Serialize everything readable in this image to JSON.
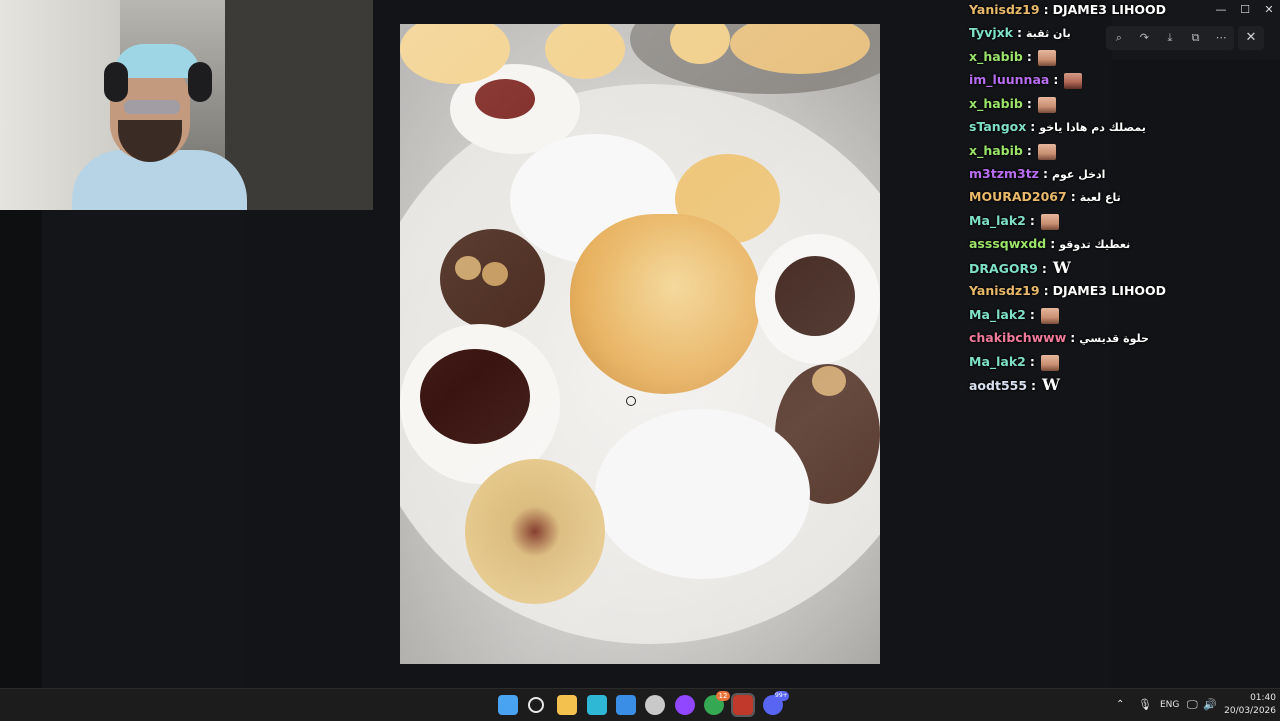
{
  "chat": {
    "lines": [
      {
        "user": "Yanisdz19",
        "user_color": "#e8b96a",
        "message": "DJAME3 LIHOOD",
        "emote": ""
      },
      {
        "user": "Tyvjxk",
        "user_color": "#7fe0c8",
        "message": "بان ثقبة",
        "emote": ""
      },
      {
        "user": "x_habib",
        "user_color": "#9be36a",
        "message": "",
        "emote": "face-emote"
      },
      {
        "user": "im_luunnaa",
        "user_color": "#b86ef0",
        "message": "",
        "emote": "face-emote-2"
      },
      {
        "user": "x_habib",
        "user_color": "#9be36a",
        "message": "",
        "emote": "face-emote"
      },
      {
        "user": "sTangox",
        "user_color": "#7fe0c8",
        "message": "يمصلك دم هادا ياخو",
        "emote": ""
      },
      {
        "user": "x_habib",
        "user_color": "#9be36a",
        "message": "",
        "emote": "face-emote"
      },
      {
        "user": "m3tzm3tz",
        "user_color": "#b86ef0",
        "message": "ادخل عوم",
        "emote": ""
      },
      {
        "user": "MOURAD2067",
        "user_color": "#e8b96a",
        "message": "تاع لعبة",
        "emote": ""
      },
      {
        "user": "Ma_lak2",
        "user_color": "#7fe0c8",
        "message": "",
        "emote": "face-emote"
      },
      {
        "user": "asssqwxdd",
        "user_color": "#9be36a",
        "message": "نعطيك تدوقو",
        "emote": ""
      },
      {
        "user": "DRAGOR9",
        "user_color": "#7fe0c8",
        "message": "",
        "emote": "w-emote"
      },
      {
        "user": "Yanisdz19",
        "user_color": "#e8b96a",
        "message": "DJAME3 LIHOOD",
        "emote": ""
      },
      {
        "user": "Ma_lak2",
        "user_color": "#7fe0c8",
        "message": "",
        "emote": "face-emote"
      },
      {
        "user": "chakibchwww",
        "user_color": "#f07a9a",
        "message": "حلوة قديسي",
        "emote": ""
      },
      {
        "user": "Ma_lak2",
        "user_color": "#7fe0c8",
        "message": "",
        "emote": "face-emote"
      },
      {
        "user": "aodt555",
        "user_color": "#d8e0f0",
        "message": "",
        "emote": "w-emote"
      }
    ],
    "separator": ":",
    "w_glyph": "W"
  },
  "viewer": {
    "toolbar_icons": [
      "zoom-icon",
      "forward-icon",
      "download-icon",
      "open-external-icon",
      "more-icon"
    ],
    "toolbar_glyphs": [
      "⌕",
      "↷",
      "⤓",
      "⧉",
      "⋯"
    ],
    "close_glyph": "✕"
  },
  "window_controls": {
    "minimize": "—",
    "maximize": "☐",
    "close": "✕"
  },
  "taskbar": {
    "tray": {
      "language": "ENG",
      "time": "01:40",
      "date": "20/03/2026"
    },
    "apps": [
      {
        "name": "start-icon",
        "color": "#4aa3f0"
      },
      {
        "name": "search-icon",
        "color": "#e8e8e8"
      },
      {
        "name": "file-explorer-icon",
        "color": "#f2c14e"
      },
      {
        "name": "edge-icon",
        "color": "#2fb7d6"
      },
      {
        "name": "store-icon",
        "color": "#3a8ee6"
      },
      {
        "name": "app-icon",
        "color": "#c9c9c9"
      },
      {
        "name": "twitch-icon",
        "color": "#9146ff"
      },
      {
        "name": "chrome-icon",
        "color": "#34a853"
      },
      {
        "name": "media-player-icon",
        "color": "#c0392b"
      },
      {
        "name": "discord-icon",
        "color": "#5865f2"
      }
    ],
    "chrome_badge": "12",
    "discord_badge": "99+"
  }
}
